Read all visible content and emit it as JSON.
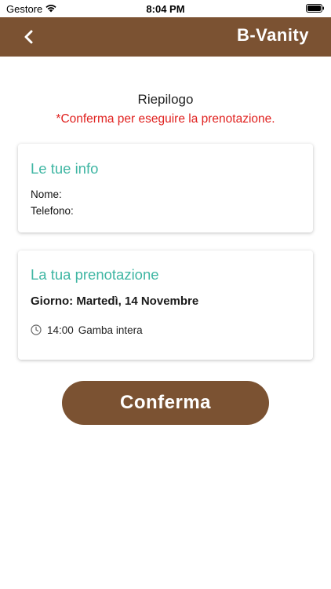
{
  "status_bar": {
    "carrier": "Gestore",
    "time": "8:04 PM"
  },
  "nav": {
    "title": "B-Vanity"
  },
  "summary": {
    "title": "Riepilogo",
    "note": "*Conferma per eseguire la prenotazione."
  },
  "info_card": {
    "heading": "Le tue info",
    "name_label": "Nome:",
    "phone_label": "Telefono:"
  },
  "booking_card": {
    "heading": "La tua prenotazione",
    "day": "Giorno: Martedì, 14 Novembre",
    "slot_time": "14:00",
    "slot_service": "Gamba intera"
  },
  "confirm_button": {
    "label": "Conferma"
  },
  "colors": {
    "brand_brown": "#7b5232",
    "accent_teal": "#3fb6a3",
    "warning_red": "#e0211f"
  }
}
